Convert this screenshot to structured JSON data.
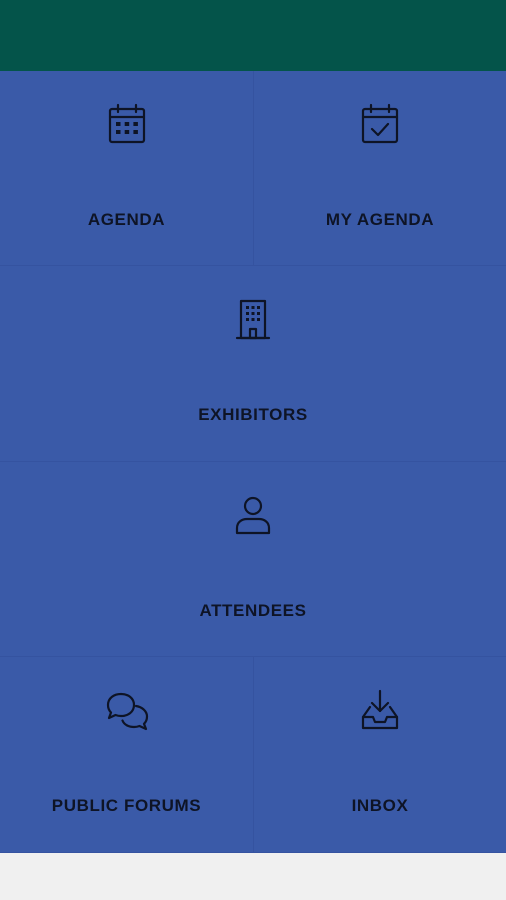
{
  "colors": {
    "header": "#04544a",
    "tile": "#3a5aa8",
    "label": "#0e1426",
    "footer": "#f0f0f0"
  },
  "tiles": [
    {
      "label": "AGENDA",
      "icon": "calendar-grid-icon"
    },
    {
      "label": "MY AGENDA",
      "icon": "calendar-check-icon"
    },
    {
      "label": "EXHIBITORS",
      "icon": "building-icon"
    },
    {
      "label": "ATTENDEES",
      "icon": "person-icon"
    },
    {
      "label": "PUBLIC FORUMS",
      "icon": "chat-bubbles-icon"
    },
    {
      "label": "INBOX",
      "icon": "inbox-download-icon"
    }
  ]
}
